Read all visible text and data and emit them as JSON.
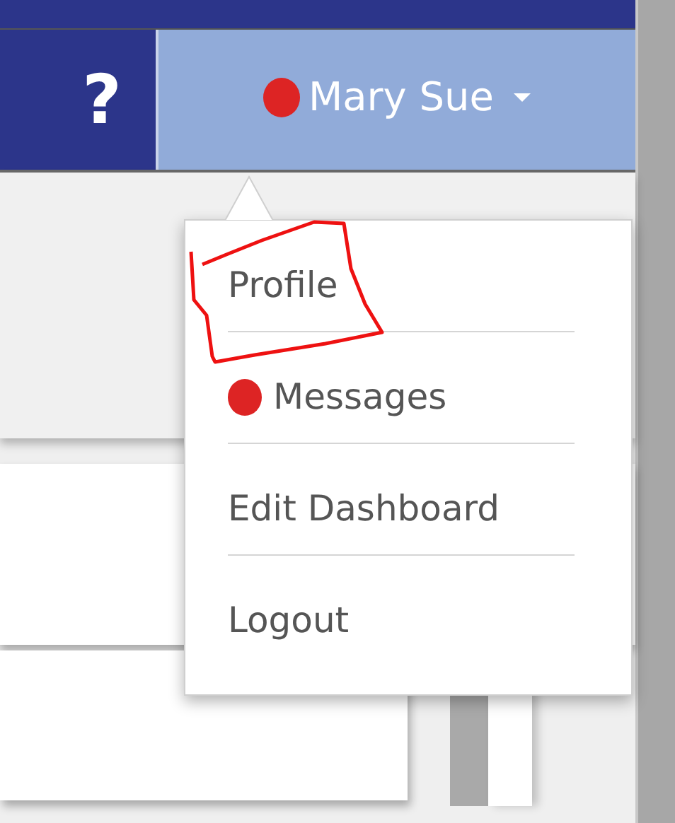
{
  "header": {
    "help_label": "?",
    "user": {
      "name": "Mary Sue",
      "alert": true
    }
  },
  "menu": {
    "items": [
      {
        "label": "Profile",
        "alert": false,
        "annotated": true
      },
      {
        "label": "Messages",
        "alert": true,
        "annotated": false
      },
      {
        "label": "Edit Dashboard",
        "alert": false,
        "annotated": false
      },
      {
        "label": "Logout",
        "alert": false,
        "annotated": false
      }
    ]
  }
}
